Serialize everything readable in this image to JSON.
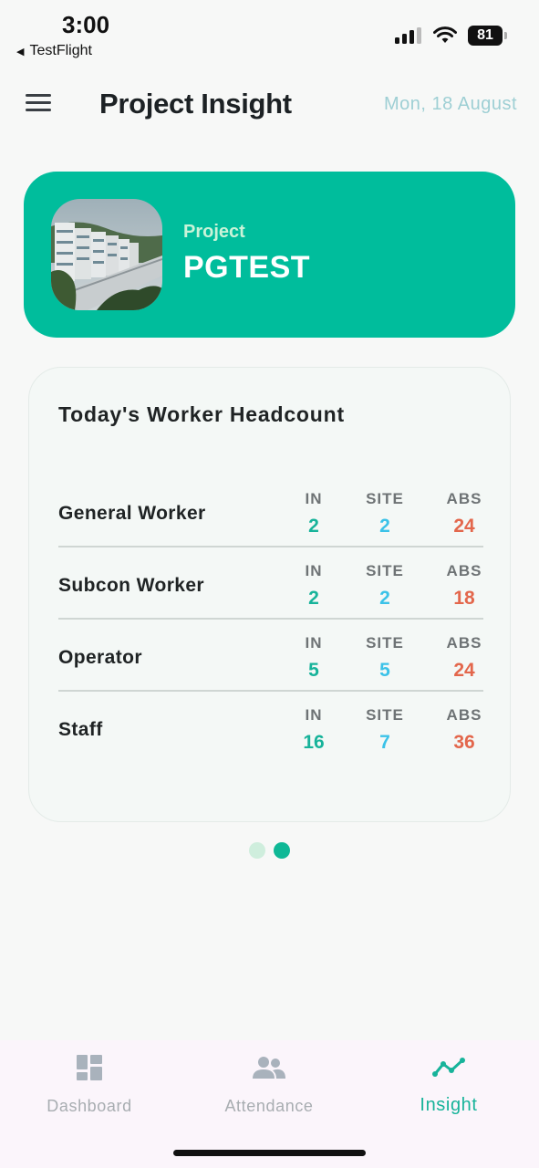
{
  "status_bar": {
    "time": "3:00",
    "back_app": "TestFlight",
    "battery": "81"
  },
  "header": {
    "title": "Project Insight",
    "date": "Mon,  18 August"
  },
  "project": {
    "label": "Project",
    "name": "PGTEST"
  },
  "headcount": {
    "title": "Today's Worker Headcount",
    "columns": [
      "IN",
      "SITE",
      "ABS"
    ],
    "rows": [
      {
        "name": "General Worker",
        "in": "2",
        "site": "2",
        "abs": "24"
      },
      {
        "name": "Subcon Worker",
        "in": "2",
        "site": "2",
        "abs": "18"
      },
      {
        "name": "Operator",
        "in": "5",
        "site": "5",
        "abs": "24"
      },
      {
        "name": "Staff",
        "in": "16",
        "site": "7",
        "abs": "36"
      }
    ]
  },
  "pager": {
    "count": 2,
    "active_index": 1
  },
  "bottom_nav": {
    "items": [
      {
        "label": "Dashboard",
        "icon": "dashboard-icon",
        "active": false
      },
      {
        "label": "Attendance",
        "icon": "people-icon",
        "active": false
      },
      {
        "label": "Insight",
        "icon": "trend-line-icon",
        "active": true
      }
    ]
  },
  "colors": {
    "accent": "#00bd9c",
    "in_value": "#17b39a",
    "site_value": "#3bc2e8",
    "abs_value": "#e3674c",
    "date_text": "#9ecfd4"
  }
}
